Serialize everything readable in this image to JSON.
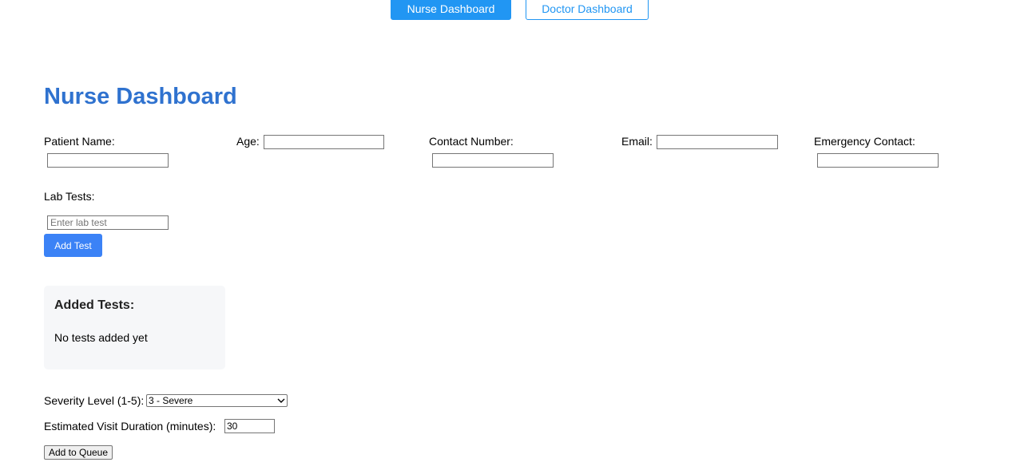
{
  "nav": {
    "nurse_tab": "Nurse Dashboard",
    "doctor_tab": "Doctor Dashboard"
  },
  "page": {
    "title": "Nurse Dashboard"
  },
  "form": {
    "patient_name_label": "Patient Name:",
    "patient_name_value": "",
    "age_label": "Age:",
    "age_value": "",
    "contact_label": "Contact Number:",
    "contact_value": "",
    "email_label": "Email:",
    "email_value": "",
    "emergency_label": "Emergency Contact:",
    "emergency_value": "",
    "lab_tests_label": "Lab Tests:",
    "lab_test_placeholder": "Enter lab test",
    "add_test_label": "Add Test"
  },
  "tests": {
    "heading": "Added Tests:",
    "empty_message": "No tests added yet"
  },
  "severity": {
    "label": "Severity Level (1-5):",
    "selected": "3 - Severe"
  },
  "duration": {
    "label": "Estimated Visit Duration (minutes):",
    "value": "30"
  },
  "actions": {
    "add_to_queue_label": "Add to Queue"
  },
  "colors": {
    "primary": "#2196f3",
    "title": "#2f72cf",
    "add_test_button": "#3b82f6",
    "panel_background": "#f6f7f9"
  }
}
